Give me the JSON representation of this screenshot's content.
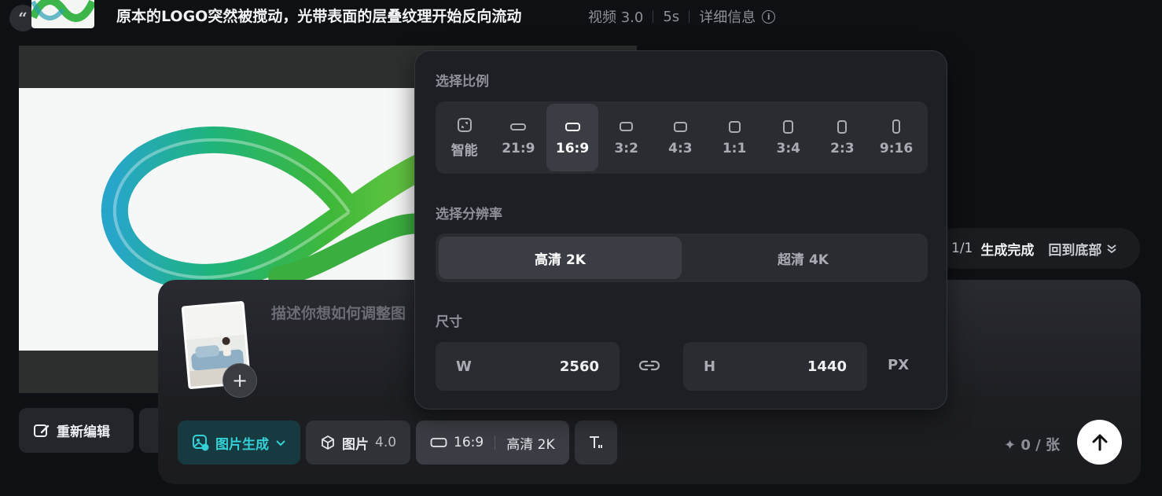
{
  "header": {
    "quote_glyph": "“",
    "title": "原本的LOGO突然被搅动，光带表面的层叠纹理开始反向流动",
    "model": "视频 3.0",
    "duration": "5s",
    "details": "详细信息"
  },
  "canvas": {
    "bg_color": "#2b302f",
    "image_bg": "#f6f7f7"
  },
  "actions": {
    "reedit_label": "重新编辑"
  },
  "status": {
    "count": "1/1",
    "state": "生成完成",
    "back_to_bottom": "回到底部"
  },
  "composer": {
    "prompt_placeholder": "描述你想如何调整图",
    "add_glyph": "+",
    "mode_label": "图片生成",
    "model_name": "图片",
    "model_version": "4.0",
    "ratio_label": "16:9",
    "resolution_label": "高清 2K",
    "credits": "✦ 0 / 张"
  },
  "panel": {
    "ratio_title": "选择比例",
    "ratios": [
      {
        "label": "智能",
        "icon": "smart-ratio-icon",
        "aspect": "smart"
      },
      {
        "label": "21:9",
        "aspect": "21:9"
      },
      {
        "label": "16:9",
        "aspect": "16:9",
        "selected": true
      },
      {
        "label": "3:2",
        "aspect": "3:2"
      },
      {
        "label": "4:3",
        "aspect": "4:3"
      },
      {
        "label": "1:1",
        "aspect": "1:1"
      },
      {
        "label": "3:4",
        "aspect": "3:4"
      },
      {
        "label": "2:3",
        "aspect": "2:3"
      },
      {
        "label": "9:16",
        "aspect": "9:16"
      }
    ],
    "resolution_title": "选择分辨率",
    "resolutions": [
      {
        "label": "高清 2K",
        "selected": true
      },
      {
        "label": "超清 4K"
      }
    ],
    "size_title": "尺寸",
    "width_label": "W",
    "width_value": "2560",
    "height_label": "H",
    "height_value": "1440",
    "unit": "PX"
  },
  "colors": {
    "accent_teal": "#33d1d6",
    "panel_bg": "#1e1f24",
    "selected_bg": "#3b3d44"
  }
}
